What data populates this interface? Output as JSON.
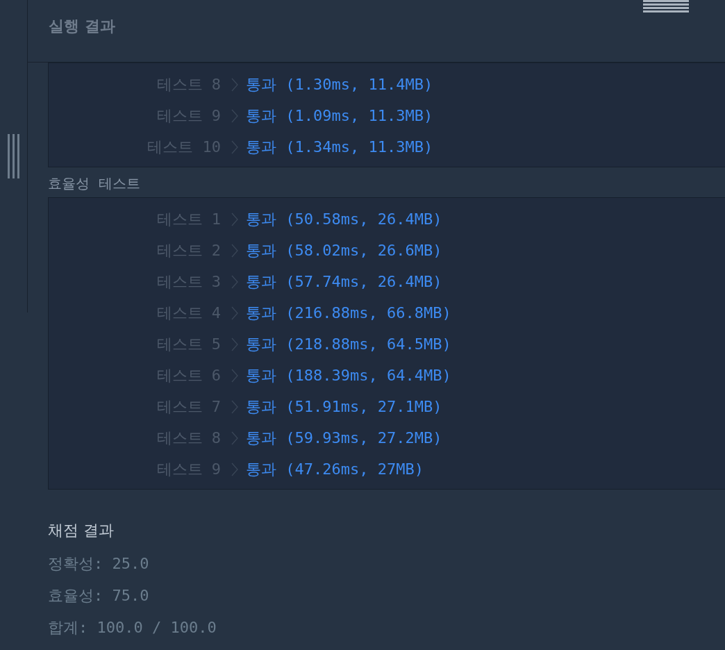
{
  "header": {
    "title": "실행 결과"
  },
  "correctness_results": [
    {
      "label": "테스트 8",
      "result": "통과 (1.30ms, 11.4MB)"
    },
    {
      "label": "테스트 9",
      "result": "통과 (1.09ms, 11.3MB)"
    },
    {
      "label": "테스트 10",
      "result": "통과 (1.34ms, 11.3MB)"
    }
  ],
  "efficiency_section": {
    "title": "효율성  테스트"
  },
  "efficiency_results": [
    {
      "label": "테스트 1",
      "result": "통과 (50.58ms, 26.4MB)"
    },
    {
      "label": "테스트 2",
      "result": "통과 (58.02ms, 26.6MB)"
    },
    {
      "label": "테스트 3",
      "result": "통과 (57.74ms, 26.4MB)"
    },
    {
      "label": "테스트 4",
      "result": "통과 (216.88ms, 66.8MB)"
    },
    {
      "label": "테스트 5",
      "result": "통과 (218.88ms, 64.5MB)"
    },
    {
      "label": "테스트 6",
      "result": "통과 (188.39ms, 64.4MB)"
    },
    {
      "label": "테스트 7",
      "result": "통과 (51.91ms, 27.1MB)"
    },
    {
      "label": "테스트 8",
      "result": "통과 (59.93ms, 27.2MB)"
    },
    {
      "label": "테스트 9",
      "result": "통과 (47.26ms, 27MB)"
    }
  ],
  "grading": {
    "title": "채점 결과",
    "lines": [
      "정확성: 25.0",
      "효율성: 75.0",
      "합계: 100.0 / 100.0"
    ]
  }
}
